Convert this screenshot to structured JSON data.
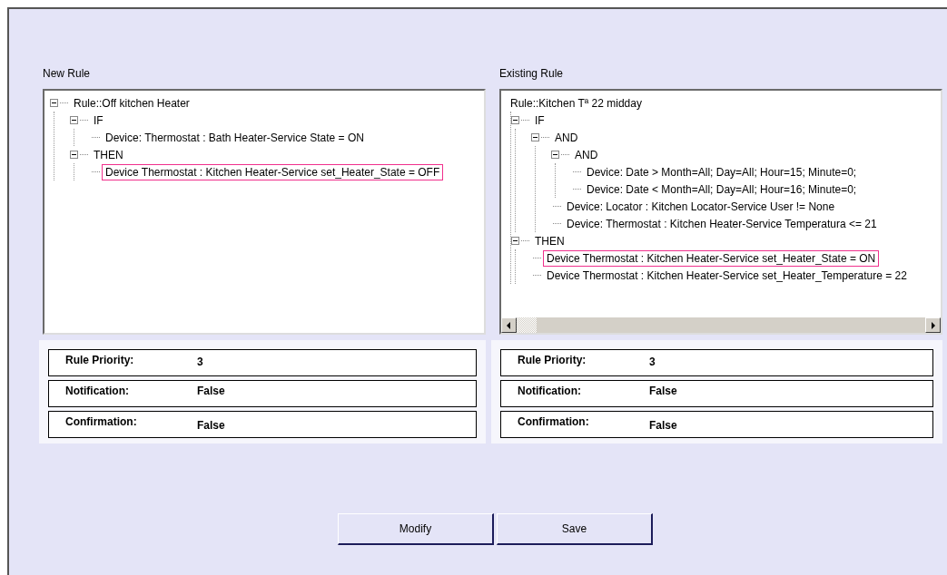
{
  "panels": [
    {
      "title": "New Rule",
      "scrollbar": false,
      "tree": [
        {
          "label": "Rule::Off kitchen Heater",
          "expanded": true,
          "highlighted": false,
          "children": [
            {
              "label": "IF",
              "expanded": true,
              "highlighted": false,
              "children": [
                {
                  "label": "Device: Thermostat : Bath Heater-Service State = ON",
                  "highlighted": false
                }
              ]
            },
            {
              "label": "THEN",
              "expanded": true,
              "highlighted": false,
              "children": [
                {
                  "label": "Device Thermostat : Kitchen Heater-Service set_Heater_State = OFF",
                  "highlighted": true
                }
              ]
            }
          ]
        }
      ],
      "properties": [
        {
          "label": "Rule Priority:",
          "value": "3"
        },
        {
          "label": "Notification:",
          "value": "False"
        },
        {
          "label": "Confirmation:",
          "value": "False"
        }
      ]
    },
    {
      "title": "Existing Rule",
      "scrollbar": true,
      "tree": [
        {
          "label": "Rule::Kitchen Tª 22 midday",
          "highlighted": false,
          "children": [
            {
              "label": "IF",
              "expanded": true,
              "highlighted": false,
              "children": [
                {
                  "label": "AND",
                  "expanded": true,
                  "highlighted": false,
                  "children": [
                    {
                      "label": "AND",
                      "expanded": true,
                      "highlighted": false,
                      "children": [
                        {
                          "label": "Device:   Date > Month=All; Day=All; Hour=15; Minute=0;",
                          "highlighted": false
                        },
                        {
                          "label": "Device:   Date < Month=All; Day=All; Hour=16; Minute=0;",
                          "highlighted": false
                        }
                      ]
                    },
                    {
                      "label": "Device: Locator : Kitchen Locator-Service User != None",
                      "highlighted": false
                    },
                    {
                      "label": "Device: Thermostat : Kitchen Heater-Service Temperatura <= 21",
                      "highlighted": false
                    }
                  ]
                }
              ]
            },
            {
              "label": "THEN",
              "expanded": true,
              "highlighted": false,
              "children": [
                {
                  "label": "Device Thermostat : Kitchen Heater-Service set_Heater_State = ON",
                  "highlighted": true
                },
                {
                  "label": "Device Thermostat : Kitchen Heater-Service set_Heater_Temperature = 22",
                  "highlighted": false
                }
              ]
            }
          ]
        }
      ],
      "properties": [
        {
          "label": "Rule Priority:",
          "value": "3"
        },
        {
          "label": "Notification:",
          "value": "False"
        },
        {
          "label": "Confirmation:",
          "value": "False"
        }
      ]
    }
  ],
  "buttons": [
    "Modify",
    "Save"
  ]
}
